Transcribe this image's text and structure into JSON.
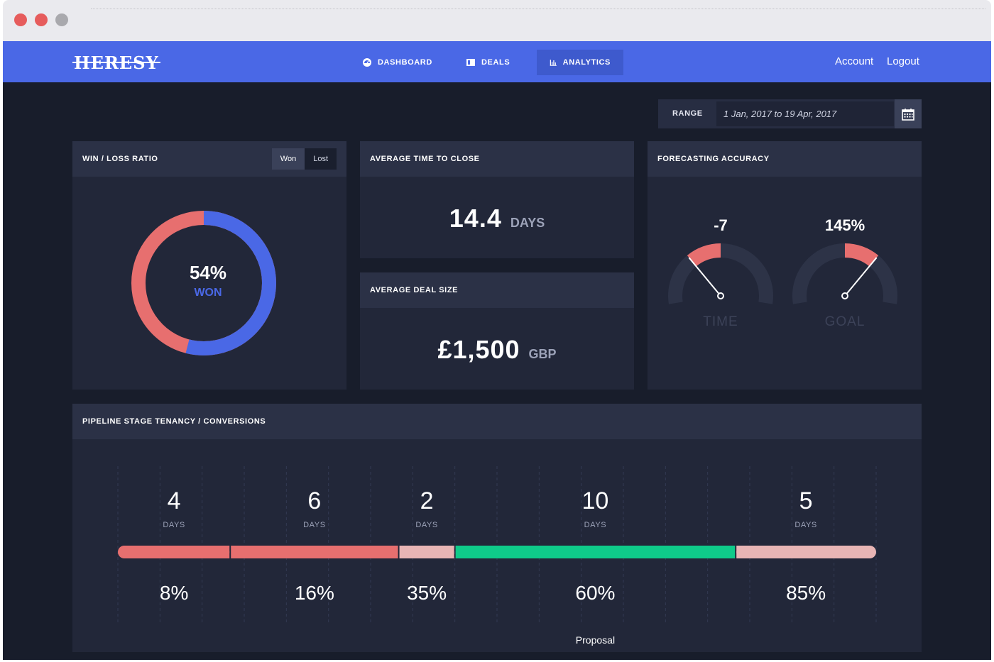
{
  "brand": {
    "logo": "HERESY",
    "accent": "#4a68e6",
    "won_color": "#4a68e6",
    "lost_color": "#e76f6f",
    "converted_color": "#0fcb8a"
  },
  "nav": {
    "items": [
      {
        "label": "DASHBOARD",
        "icon": "dashboard-icon"
      },
      {
        "label": "DEALS",
        "icon": "deals-icon"
      },
      {
        "label": "ANALYTICS",
        "icon": "analytics-icon",
        "active": true
      }
    ],
    "account": "Account",
    "logout": "Logout"
  },
  "range": {
    "label": "RANGE",
    "value": "1 Jan, 2017 to 19 Apr, 2017",
    "icon": "calendar-icon"
  },
  "win_loss": {
    "title": "WIN / LOSS RATIO",
    "toggle": {
      "won": "Won",
      "lost": "Lost",
      "selected": "Won"
    },
    "percent_text": "54%",
    "label": "WON",
    "won_fraction": 0.54
  },
  "time_to_close": {
    "title": "AVERAGE TIME TO CLOSE",
    "value": "14.4",
    "unit": "DAYS"
  },
  "deal_size": {
    "title": "AVERAGE DEAL SIZE",
    "value": "£1,500",
    "unit": "GBP"
  },
  "forecasting": {
    "title": "FORECASTING ACCURACY",
    "gauges": [
      {
        "value_text": "-7",
        "label": "TIME",
        "level": 0.3
      },
      {
        "value_text": "145%",
        "label": "GOAL",
        "level": 0.7
      }
    ]
  },
  "pipeline": {
    "title": "PIPELINE STAGE TENANCY / CONVERSIONS",
    "days_unit": "DAYS",
    "stages": [
      {
        "days": "4",
        "conversion": "8%",
        "label": ""
      },
      {
        "days": "6",
        "conversion": "16%",
        "label": ""
      },
      {
        "days": "2",
        "conversion": "35%",
        "label": ""
      },
      {
        "days": "10",
        "conversion": "60%",
        "label": "Proposal"
      },
      {
        "days": "5",
        "conversion": "85%",
        "label": ""
      }
    ]
  }
}
